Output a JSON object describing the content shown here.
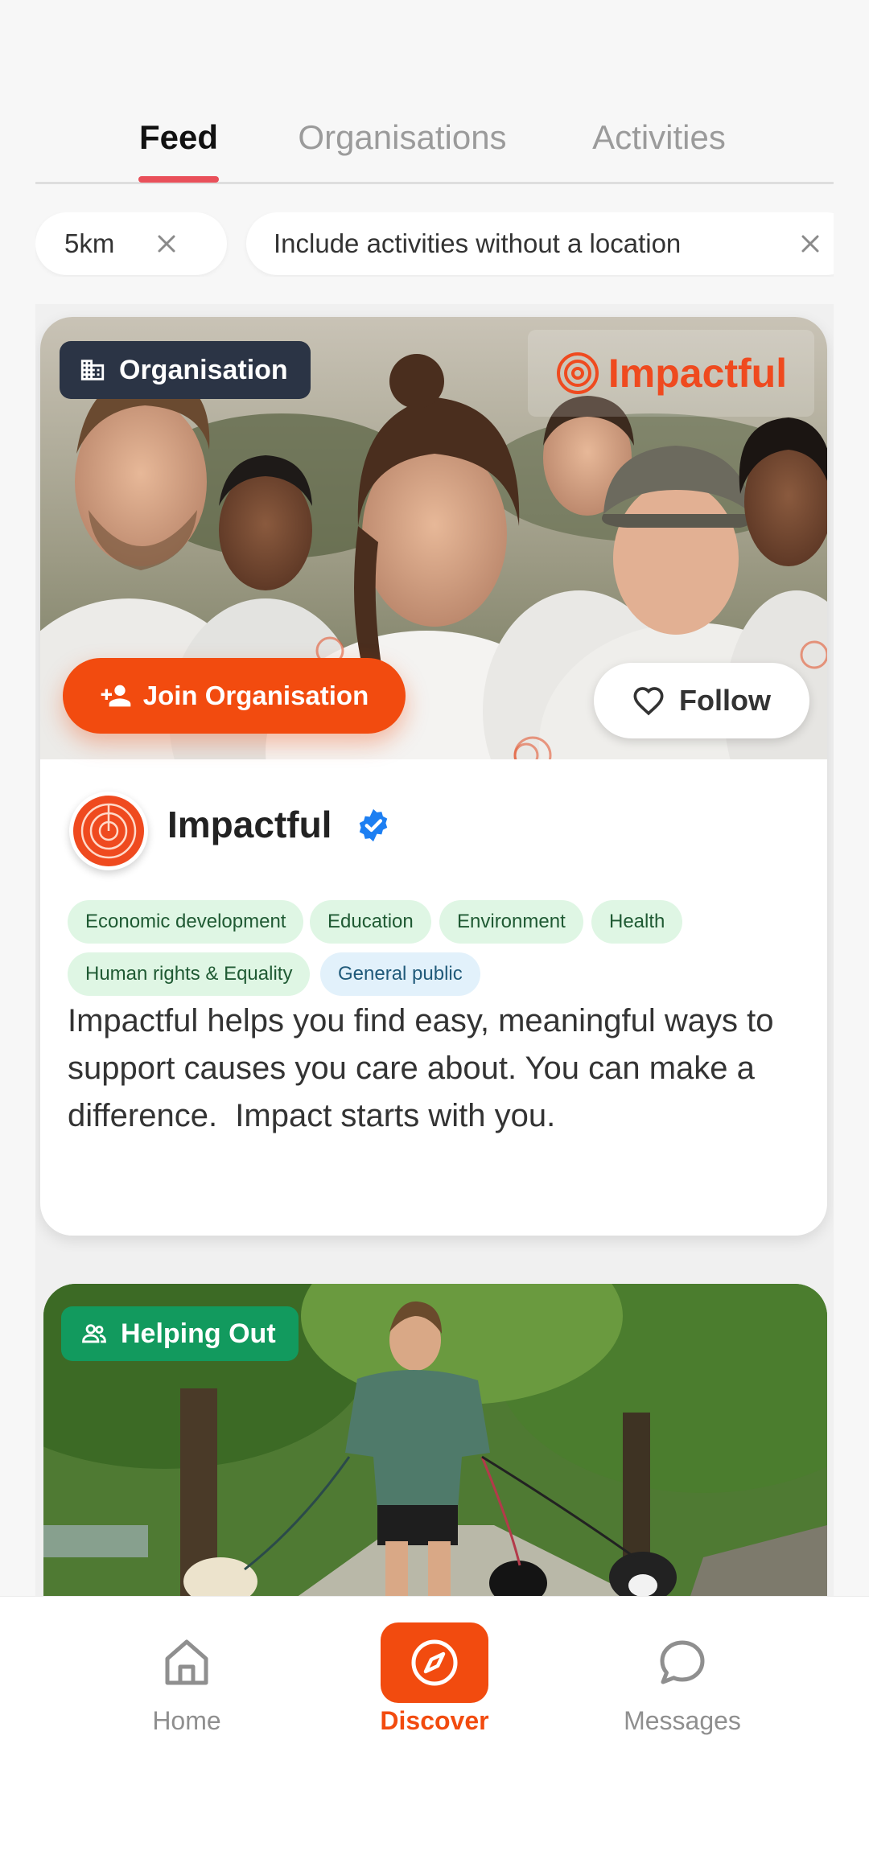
{
  "tabs": [
    {
      "label": "Feed",
      "active": true
    },
    {
      "label": "Organisations",
      "active": false
    },
    {
      "label": "Activities",
      "active": false
    }
  ],
  "filters": [
    {
      "label": "5km"
    },
    {
      "label": "Include activities without a location"
    }
  ],
  "org_card": {
    "badge": "Organisation",
    "brand_text": "Impactful",
    "join_label": "Join Organisation",
    "follow_label": "Follow",
    "name": "Impactful",
    "verified": true,
    "tags": [
      {
        "label": "Economic development",
        "color": "#dff6e4"
      },
      {
        "label": "Education",
        "color": "#dff6e4"
      },
      {
        "label": "Environment",
        "color": "#dff6e4"
      },
      {
        "label": "Health",
        "color": "#dff6e4"
      },
      {
        "label": "Human rights & Equality",
        "color": "#dff6e4"
      },
      {
        "label": "General public",
        "color": "#e2f1fb"
      }
    ],
    "description": "Impactful helps you find easy, meaningful ways to support causes you care about. You can make a difference.  Impact starts with you."
  },
  "activity_card": {
    "badge": "Helping Out"
  },
  "bottom_nav": [
    {
      "label": "Home",
      "icon": "home-icon",
      "active": false
    },
    {
      "label": "Discover",
      "icon": "compass-icon",
      "active": true
    },
    {
      "label": "Messages",
      "icon": "chat-bubble-icon",
      "active": false
    }
  ],
  "colors": {
    "accent": "#f24b0f",
    "tab_indicator": "#e9505a",
    "org_badge": "#2b3445",
    "activity_badge": "#129a5e",
    "verified": "#1d7ff2"
  }
}
